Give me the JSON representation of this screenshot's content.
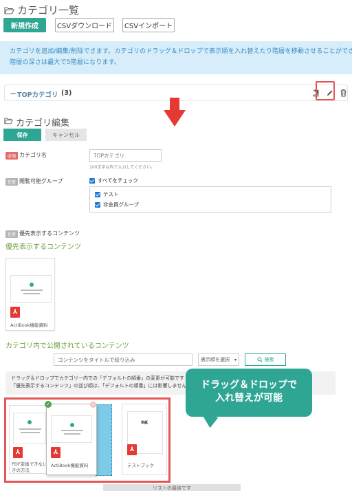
{
  "header": {
    "title": "カテゴリ一覧",
    "new_button": "新規作成",
    "csv_download": "CSVダウンロード",
    "csv_import": "CSVインポート"
  },
  "info": {
    "line1": "カテゴリを追加/編集/削除できます。カテゴリのドラッグ＆ドロップで表示順を入れ替えたり階層を移動させることができます",
    "line2": "階層の深さは最大で5階層になります。"
  },
  "category_row": {
    "name": "TOPカテゴリ",
    "count": "(3)"
  },
  "edit": {
    "title": "カテゴリ編集",
    "save": "保存",
    "cancel": "キャンセル",
    "required_badge": "必須",
    "optional_badge": "任意",
    "name_label": "カテゴリ名",
    "name_value": "TOPカテゴリ",
    "name_hint": "100文字以内で入力してください。",
    "group_label": "閲覧可能グループ",
    "check_all": "すべてをチェック",
    "groups": [
      "テスト",
      "非会員グループ"
    ],
    "priority_label": "優先表示するコンテンツ",
    "priority_heading": "優先表示するコンテンツ",
    "priority_card_label": "ActiBook機能資料",
    "published_heading": "カテゴリ内で公開されているコンテンツ",
    "filter_placeholder": "コンテンツをタイトルで絞り込み",
    "sort_value": "表示順を選択",
    "search_button": "検索",
    "drag_info_line1": "ドラッグ＆ドロップでカテゴリー内での「デフォルトの順番」の変更が可能です",
    "drag_info_line2": "「優先表示するコンテンツ」の並び順は、「デフォルトの順番」には影響しません",
    "callout_line1": "ドラッグ＆ドロップで",
    "callout_line2": "入れ替えが可能",
    "cards": [
      {
        "label_line1": "PDF変換できない",
        "label_line2": "きの方法"
      },
      {
        "label_line1": "ActiBook機能資料"
      },
      {
        "label_line1": "テストブック",
        "cover_text": "表紙"
      }
    ],
    "list_end": "リストの最後です"
  },
  "colors": {
    "accent": "#2fa593",
    "info_bg": "#d7edf9",
    "highlight": "#e55555",
    "heading_green": "#6a9e3b"
  }
}
